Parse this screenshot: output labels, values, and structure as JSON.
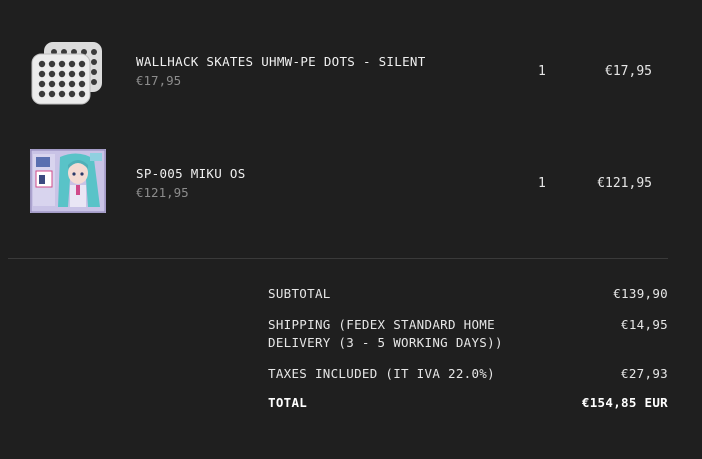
{
  "items": [
    {
      "name": "WALLHACK SKATES UHMW-PE DOTS - SILENT",
      "unit_price": "€17,95",
      "quantity": "1",
      "total": "€17,95",
      "icon": "dots-sheet-icon"
    },
    {
      "name": "SP-005 MIKU OS",
      "unit_price": "€121,95",
      "quantity": "1",
      "total": "€121,95",
      "icon": "miku-artwork-thumbnail"
    }
  ],
  "summary": {
    "subtotal_label": "SUBTOTAL",
    "subtotal_value": "€139,90",
    "shipping_label": "SHIPPING (FEDEX STANDARD HOME DELIVERY (3 - 5 WORKING DAYS))",
    "shipping_value": "€14,95",
    "taxes_label": "TAXES INCLUDED (IT IVA 22.0%)",
    "taxes_value": "€27,93",
    "total_label": "TOTAL",
    "total_value": "€154,85 EUR"
  },
  "colors": {
    "background": "#1f1f1f",
    "text": "#e6e6e6",
    "muted": "#8c8c8c",
    "divider": "#3a3a3a"
  }
}
